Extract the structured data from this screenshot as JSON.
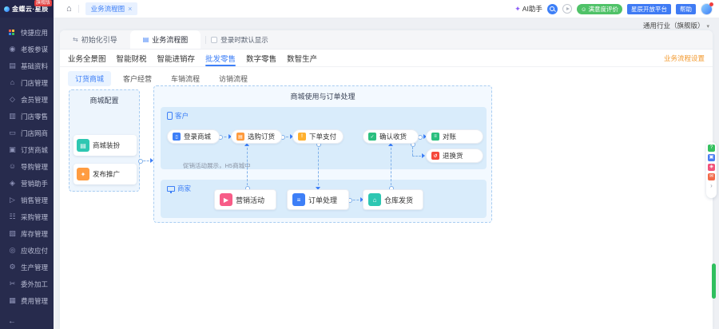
{
  "app": {
    "logo_text": "金蝶云·星辰",
    "logo_badge": "旗舰版",
    "accent_color": "#3d7ff7",
    "sidebar_color": "#272b4d"
  },
  "topbar": {
    "home_glyph": "⌂",
    "tab": {
      "label": "业务流程图",
      "close": "×"
    },
    "ai_assistant": {
      "glyph": "✦",
      "label": "AI助手"
    },
    "satisfaction": {
      "glyph": "☺",
      "label": "满意度评价",
      "color": "#4fc268"
    },
    "open_platform": {
      "label": "星辰开放平台",
      "color": "#3f7bf4"
    },
    "help": {
      "label": "帮助",
      "color": "#3f7bf4"
    },
    "industry_selector": {
      "label": "通用行业（旗舰版）",
      "chevron": "▾"
    }
  },
  "sidebar": {
    "items": [
      {
        "icon": "quick-apps-icon",
        "glyph": "",
        "label": "快捷应用"
      },
      {
        "icon": "boss-advisor-icon",
        "glyph": "◉",
        "label": "老板参谋"
      },
      {
        "icon": "base-data-icon",
        "glyph": "▤",
        "label": "基础资料"
      },
      {
        "icon": "store-manage-icon",
        "glyph": "⌂",
        "label": "门店管理"
      },
      {
        "icon": "member-manage-icon",
        "glyph": "◇",
        "label": "会员管理"
      },
      {
        "icon": "store-retail-icon",
        "glyph": "▥",
        "label": "门店零售"
      },
      {
        "icon": "store-online-icon",
        "glyph": "▭",
        "label": "门店网商"
      },
      {
        "icon": "order-mall-icon",
        "glyph": "▣",
        "label": "订货商城"
      },
      {
        "icon": "guide-manage-icon",
        "glyph": "☺",
        "label": "导购管理"
      },
      {
        "icon": "marketing-helper-icon",
        "glyph": "◈",
        "label": "营销助手"
      },
      {
        "icon": "sales-manage-icon",
        "glyph": "▷",
        "label": "销售管理"
      },
      {
        "icon": "purchase-manage-icon",
        "glyph": "☷",
        "label": "采购管理"
      },
      {
        "icon": "inventory-manage-icon",
        "glyph": "▧",
        "label": "库存管理"
      },
      {
        "icon": "receivable-payable-icon",
        "glyph": "◎",
        "label": "应收应付"
      },
      {
        "icon": "production-manage-icon",
        "glyph": "⚙",
        "label": "生产管理"
      },
      {
        "icon": "outsourcing-icon",
        "glyph": "✂",
        "label": "委外加工"
      },
      {
        "icon": "expense-manage-icon",
        "glyph": "▦",
        "label": "费用管理"
      }
    ],
    "collapse_glyph": "←"
  },
  "workspace": {
    "tabs": {
      "guide": {
        "glyph": "⇆",
        "label": "初始化引导"
      },
      "flow": {
        "glyph": "▤",
        "label": "业务流程图"
      },
      "checkbox_label": "登录时默认显示",
      "checkbox_checked": false
    },
    "nav_tabs": [
      "业务全景图",
      "智能财税",
      "智能进销存",
      "批发零售",
      "数字零售",
      "数智生产"
    ],
    "active_nav_tab": "批发零售",
    "settings_link": "业务流程设置",
    "sub_tabs": [
      "订货商城",
      "客户经营",
      "车销流程",
      "访销流程"
    ],
    "active_sub_tab": "订货商城"
  },
  "flow": {
    "left": {
      "title": "商城配置",
      "items": [
        {
          "icon": "mall-decorate-icon",
          "glyph": "▤",
          "color": "#2ec7b2",
          "label": "商城装扮"
        },
        {
          "icon": "publish-promote-icon",
          "glyph": "✦",
          "color": "#ff9c41",
          "label": "发布推广"
        }
      ]
    },
    "right": {
      "title": "商城使用与订单处理",
      "annotation": "促销活动展示，H5商城中",
      "lanes": [
        {
          "label": "客户",
          "icon": "phone-icon",
          "nodes": [
            {
              "icon": "login-mall-icon",
              "glyph": "▯",
              "color": "#3d7ff7",
              "label": "登录商城"
            },
            {
              "icon": "select-order-icon",
              "glyph": "▤",
              "color": "#ff9a3c",
              "label": "选购订货"
            },
            {
              "icon": "pay-order-icon",
              "glyph": "!",
              "color": "#ffb02e",
              "label": "下单支付"
            },
            {
              "icon": "confirm-receipt-icon",
              "glyph": "✓",
              "color": "#2bbf7f",
              "label": "确认收货"
            },
            {
              "icon": "reconcile-icon",
              "glyph": "≡",
              "color": "#2bbf7f",
              "label": "对账"
            },
            {
              "icon": "return-exchange-icon",
              "glyph": "↺",
              "color": "#f5483b",
              "label": "退换货"
            }
          ]
        },
        {
          "label": "商家",
          "icon": "monitor-icon",
          "nodes": [
            {
              "icon": "marketing-activity-icon",
              "glyph": "▶",
              "color": "#f75c87",
              "label": "营销活动"
            },
            {
              "icon": "order-process-icon",
              "glyph": "≡",
              "color": "#3d7ff7",
              "label": "订单处理"
            },
            {
              "icon": "warehouse-ship-icon",
              "glyph": "⌂",
              "color": "#2ec7b2",
              "label": "仓库发货"
            }
          ]
        }
      ]
    }
  },
  "side_toolbar": {
    "icons": [
      {
        "name": "question-icon",
        "glyph": "?",
        "color": "#35c05f"
      },
      {
        "name": "app-widget-icon",
        "glyph": "▣",
        "color": "#4a7df0"
      },
      {
        "name": "feedback-icon",
        "glyph": "◈",
        "color": "#f2527a"
      },
      {
        "name": "promo-icon",
        "glyph": "✉",
        "color": "#f26a4a"
      }
    ],
    "more_glyph": "›"
  }
}
